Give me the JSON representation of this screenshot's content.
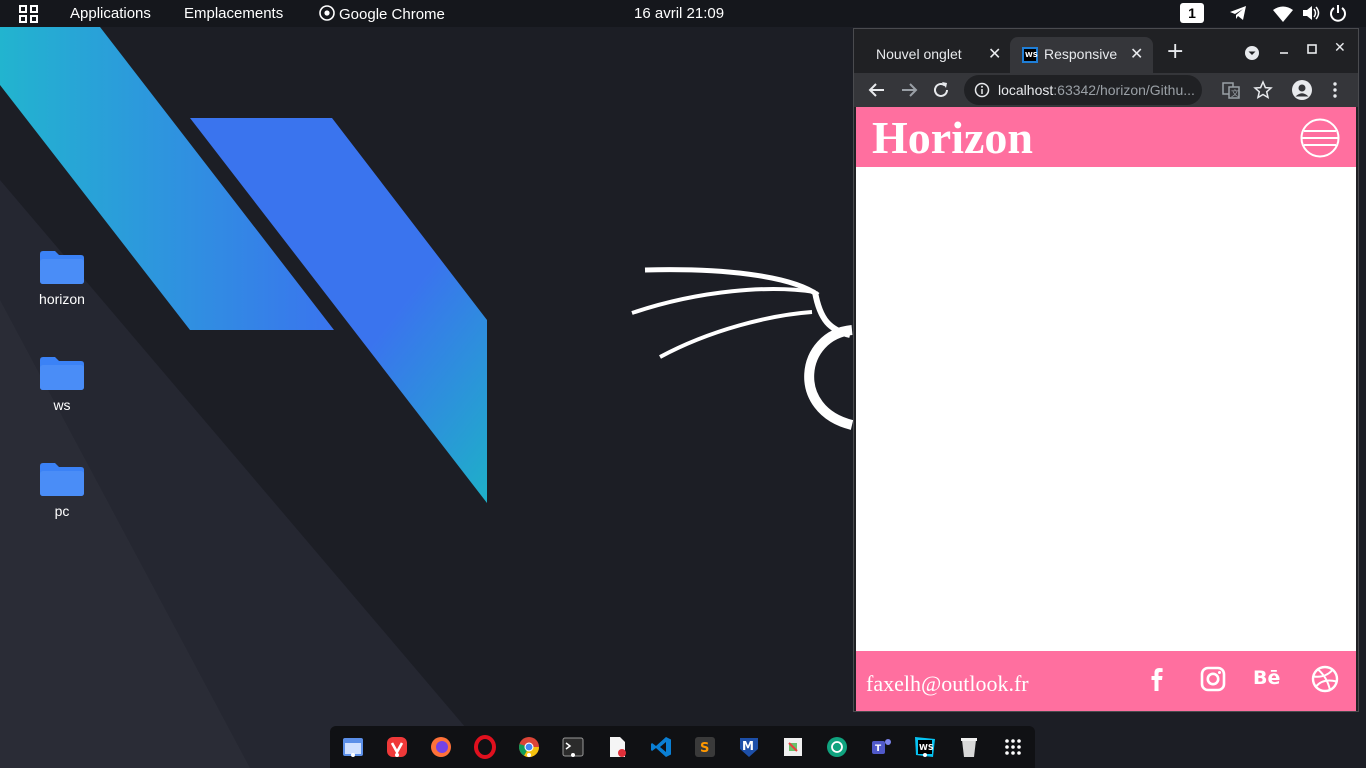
{
  "topbar": {
    "applications_label": "Applications",
    "places_label": "Emplacements",
    "active_app_label": "Google Chrome",
    "clock": "16 avril  21:09",
    "workspace_number": "1"
  },
  "desktop": {
    "icons": [
      {
        "label": "horizon"
      },
      {
        "label": "ws"
      },
      {
        "label": "pc"
      }
    ]
  },
  "browser": {
    "tabs": [
      {
        "label": "Nouvel onglet",
        "active": false
      },
      {
        "label": "Responsive",
        "active": true
      }
    ],
    "url_host": "localhost",
    "url_rest": ":63342/horizon/Githu..."
  },
  "site": {
    "title": "Horizon",
    "email": "faxelh@outlook.fr",
    "social": [
      "facebook-icon",
      "instagram-icon",
      "behance-icon",
      "dribbble-icon"
    ],
    "behance_text": "Bē"
  },
  "dock": {
    "apps": [
      "files",
      "vivaldi",
      "firefox",
      "opera",
      "chrome",
      "terminal",
      "text-editor",
      "vscode",
      "sublime",
      "metasploit",
      "app-store",
      "openai",
      "teams",
      "webstorm",
      "trash",
      "app-grid"
    ]
  },
  "colors": {
    "site_accent": "#ff6f9f",
    "folder": "#3b82f6",
    "wallpaper_bg": "#1c1e25"
  }
}
